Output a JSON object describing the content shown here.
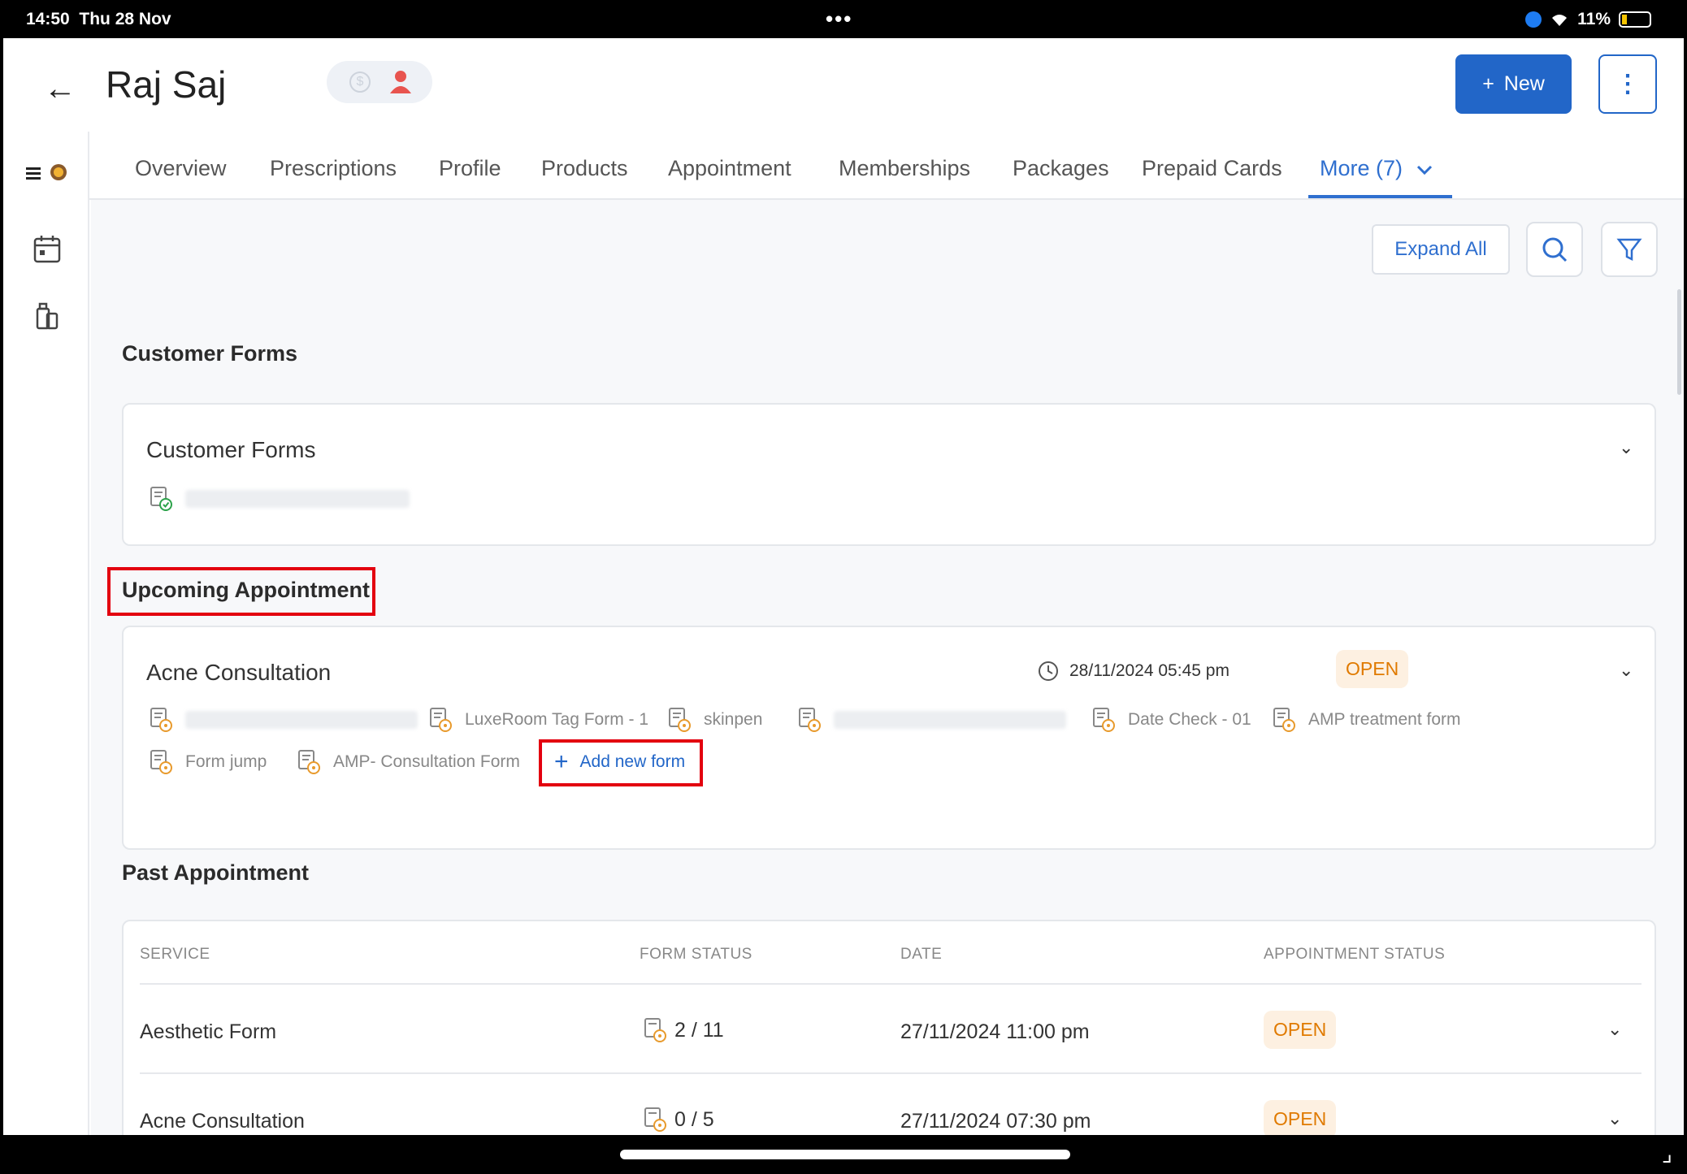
{
  "status_bar": {
    "time": "14:50",
    "date": "Thu 28 Nov",
    "battery": "11%"
  },
  "header": {
    "title": "Raj Saj",
    "new_label": "New"
  },
  "tabs": [
    {
      "label": "Overview"
    },
    {
      "label": "Prescriptions"
    },
    {
      "label": "Profile"
    },
    {
      "label": "Products"
    },
    {
      "label": "Appointment"
    },
    {
      "label": "Memberships"
    },
    {
      "label": "Packages"
    },
    {
      "label": "Prepaid Cards"
    },
    {
      "label": "More (7)",
      "active": true
    }
  ],
  "toolbar": {
    "expand_all": "Expand All"
  },
  "customer_forms": {
    "section_title": "Customer Forms",
    "card_title": "Customer Forms"
  },
  "upcoming": {
    "section_title": "Upcoming Appointment",
    "service": "Acne Consultation",
    "datetime": "28/11/2024 05:45 pm",
    "status": "OPEN",
    "forms": [
      "LuxeRoom Tag Form - 1",
      "skinpen",
      "Date Check - 01",
      "AMP treatment form",
      "Form jump",
      "AMP- Consultation Form"
    ],
    "add_form": "Add new form"
  },
  "past": {
    "section_title": "Past Appointment",
    "columns": [
      "SERVICE",
      "FORM STATUS",
      "DATE",
      "APPOINTMENT STATUS"
    ],
    "rows": [
      {
        "service": "Aesthetic Form",
        "form_status": "2 / 11",
        "date": "27/11/2024 11:00 pm",
        "status": "OPEN"
      },
      {
        "service": "Acne Consultation",
        "form_status": "0 / 5",
        "date": "27/11/2024 07:30 pm",
        "status": "OPEN"
      }
    ]
  },
  "colors": {
    "primary": "#2266c8",
    "tab_active": "#2f6fcf",
    "open_text": "#e07a00",
    "open_bg": "#fdf0e1",
    "highlight": "#e3000f"
  }
}
